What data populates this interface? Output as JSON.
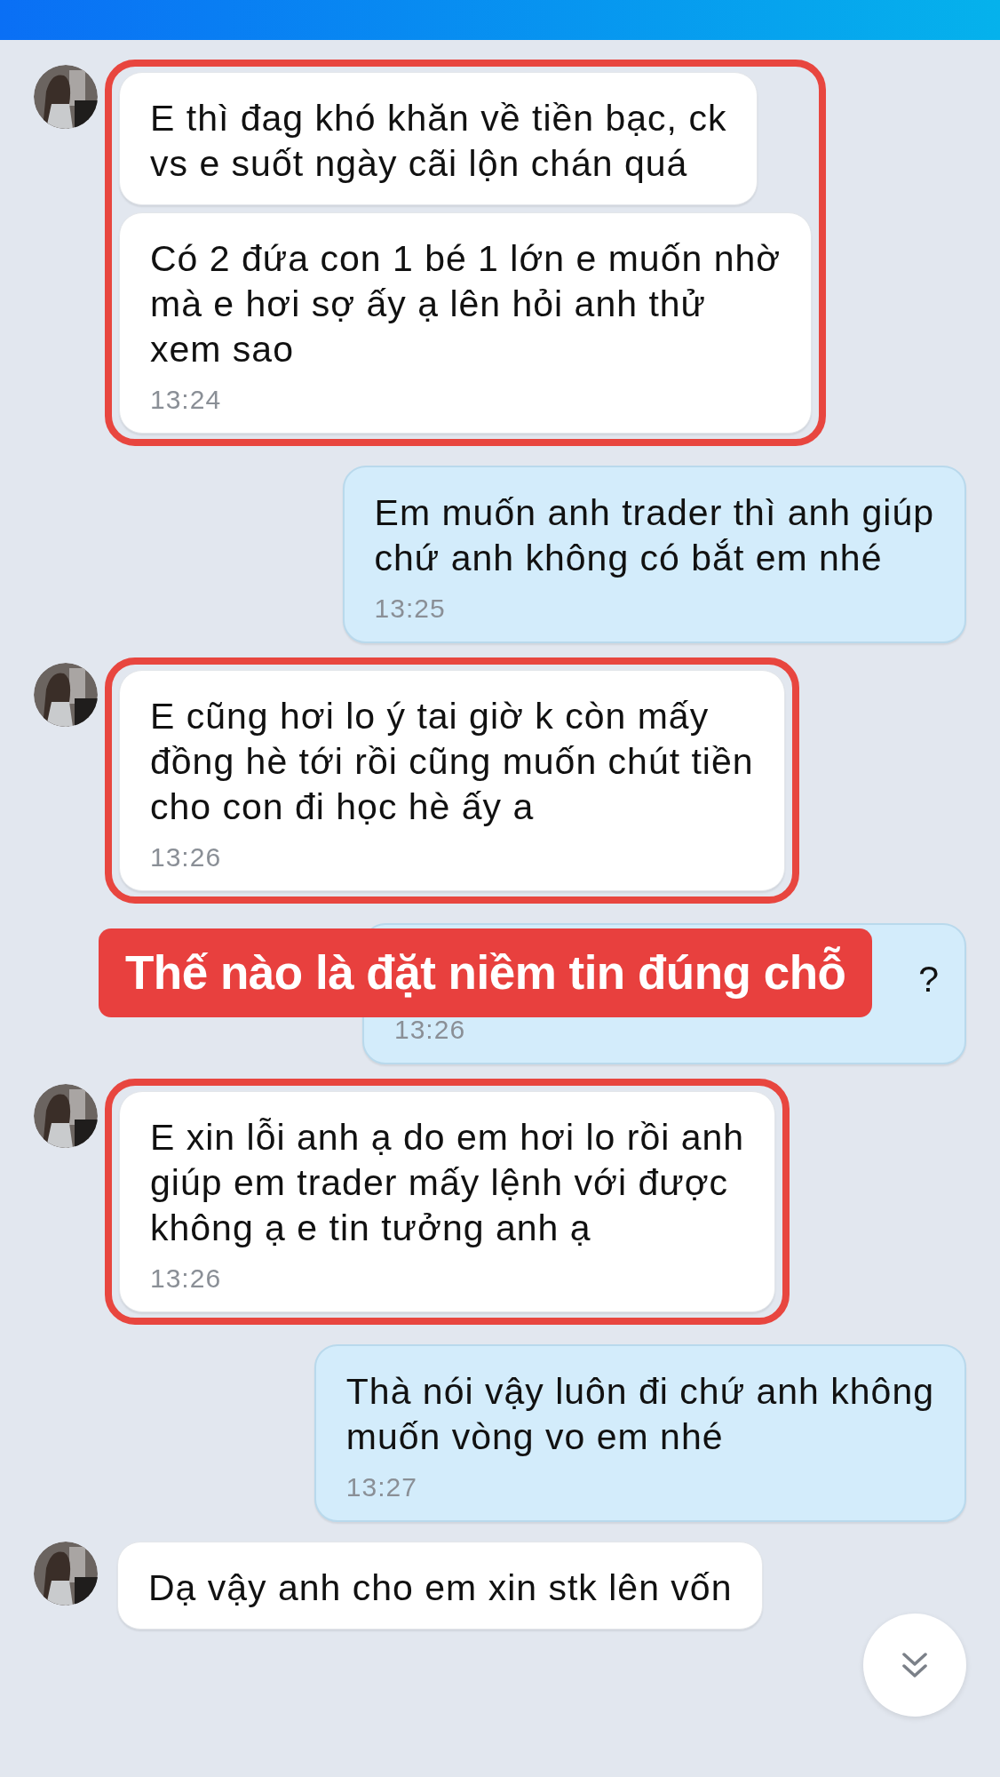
{
  "header": {
    "kind": "bar"
  },
  "messages": [
    {
      "kind": "incoming",
      "highlighted": true,
      "bubbles": [
        {
          "text": "E thì đag khó khăn về tiền bạc, ck\nvs e suốt ngày cãi lộn chán quá"
        },
        {
          "text": "Có 2 đứa con 1 bé 1 lớn e muốn nhờ\nmà e hơi sợ ấy ạ lên hỏi anh thử\nxem sao",
          "time": "13:24"
        }
      ]
    },
    {
      "kind": "outgoing",
      "highlighted": false,
      "bubbles": [
        {
          "text": "Em muốn anh trader thì anh giúp\nchứ anh không có bắt em nhé",
          "time": "13:25"
        }
      ]
    },
    {
      "kind": "incoming",
      "highlighted": true,
      "bubbles": [
        {
          "text": "E cũng hơi lo ý tai giờ k còn mấy\nđồng hè tới rồi cũng muốn chút tiền\ncho con đi học hè ấy a",
          "time": "13:26"
        }
      ]
    },
    {
      "kind": "outgoing",
      "highlighted": false,
      "caption": "Thế nào là đặt niềm tin đúng chỗ",
      "bubbles": [
        {
          "text": "?",
          "time": "13:26"
        }
      ]
    },
    {
      "kind": "incoming",
      "highlighted": true,
      "bubbles": [
        {
          "text": "E xin lỗi anh ạ do em hơi lo rồi anh\ngiúp em trader mấy lệnh với được\nkhông ạ e tin tưởng anh ạ",
          "time": "13:26"
        }
      ]
    },
    {
      "kind": "outgoing",
      "highlighted": false,
      "bubbles": [
        {
          "text": "Thà nói vậy luôn đi chứ anh không\nmuốn vòng vo em nhé",
          "time": "13:27"
        }
      ]
    },
    {
      "kind": "incoming",
      "highlighted": false,
      "bubbles": [
        {
          "text": "Dạ vậy anh cho em xin stk lên vốn"
        }
      ]
    }
  ]
}
